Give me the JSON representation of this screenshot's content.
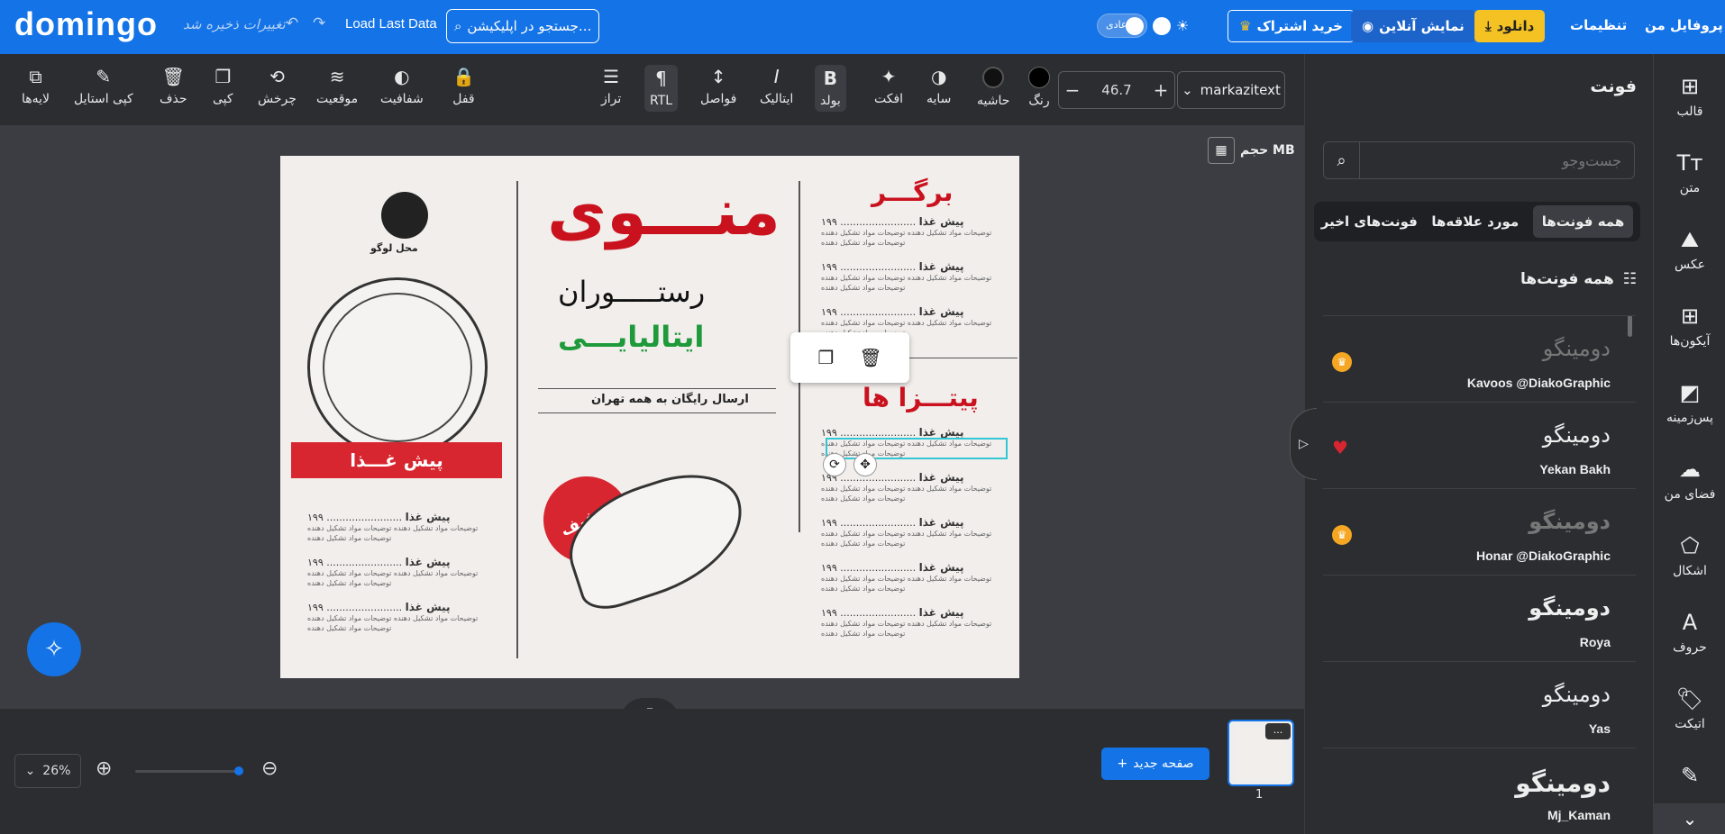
{
  "topbar": {
    "logo": "domingo",
    "unsaved": "تغییرات ذخیره شد",
    "load_last": "Load Last Data",
    "search_text": "جستجو در اپلیکیشن...",
    "mode_label": "عادی",
    "subscribe": "خرید اشتراک",
    "online_preview": "نمایش آنلاین",
    "download": "دانلود",
    "settings": "تنظیمات",
    "profile": "پروفایل من"
  },
  "toolbar": {
    "layers": "لایه‌ها",
    "copy_style": "کپی استایل",
    "delete": "حذف",
    "copy": "کپی",
    "rotate": "چرخش",
    "position": "موقعیت",
    "opacity": "شفافیت",
    "lock": "قفل",
    "align": "تراز",
    "rtl": "RTL",
    "spacing": "فواصل",
    "italic": "ایتالیک",
    "bold": "بولد",
    "effect": "افکت",
    "shadow": "سایه",
    "border": "حاشیه",
    "color": "رنگ",
    "font_size": "46.7",
    "font_name": "markazitext"
  },
  "canvas": {
    "mb_label": "حجم MB",
    "menu_word": "منـــوی",
    "restaurant": "رستـــــوران",
    "italian": "ایتالیایـــی",
    "free_delivery": "ارسال رایگان به همه تهران",
    "logo_place": "محل لوگو",
    "burger": "برگـــر",
    "pizzas": "پیتـــزا ها",
    "appetizer": "پیش غـــذا",
    "discount": "تخفیف",
    "item_name": "پیش غذا",
    "item_price": "۱۹۹",
    "item_desc": "توضیحات مواد تشکیل دهنده توضیحات مواد تشکیل دهنده توضیحات مواد تشکیل دهنده"
  },
  "bottom": {
    "zoom": "26%",
    "new_page": "صفحه جدید",
    "page_number": "1",
    "thumb_more": "..."
  },
  "panel": {
    "title": "فونت",
    "search_placeholder": "جست‌وجو",
    "tabs": [
      "همه فونت‌ها",
      "مورد علاقه‌ها",
      "فونت‌های اخیر"
    ],
    "all_fonts": "همه فونت‌ها",
    "fonts": [
      {
        "sample": "دومینگو",
        "name": "Kavoos @DiakoGraphic"
      },
      {
        "sample": "دومینگو",
        "name": "Yekan Bakh"
      },
      {
        "sample": "دومینگو",
        "name": "Honar @DiakoGraphic"
      },
      {
        "sample": "دومینگو",
        "name": "Roya"
      },
      {
        "sample": "دومینگو",
        "name": "Yas"
      },
      {
        "sample": "دومینگو",
        "name": "Mj_Kaman"
      }
    ]
  },
  "rightnav": {
    "template": "قالب",
    "text": "متن",
    "photo": "عکس",
    "icons": "آیکون‌ها",
    "background": "پس‌زمینه",
    "my_space": "فضای من",
    "shapes": "اشکال",
    "letters": "حروف",
    "label": "اتیکت"
  },
  "colors": {
    "accent": "#1473e6",
    "menu_red": "#c9121e",
    "italian_green": "#1e9a3a",
    "gold": "#f5c224"
  }
}
